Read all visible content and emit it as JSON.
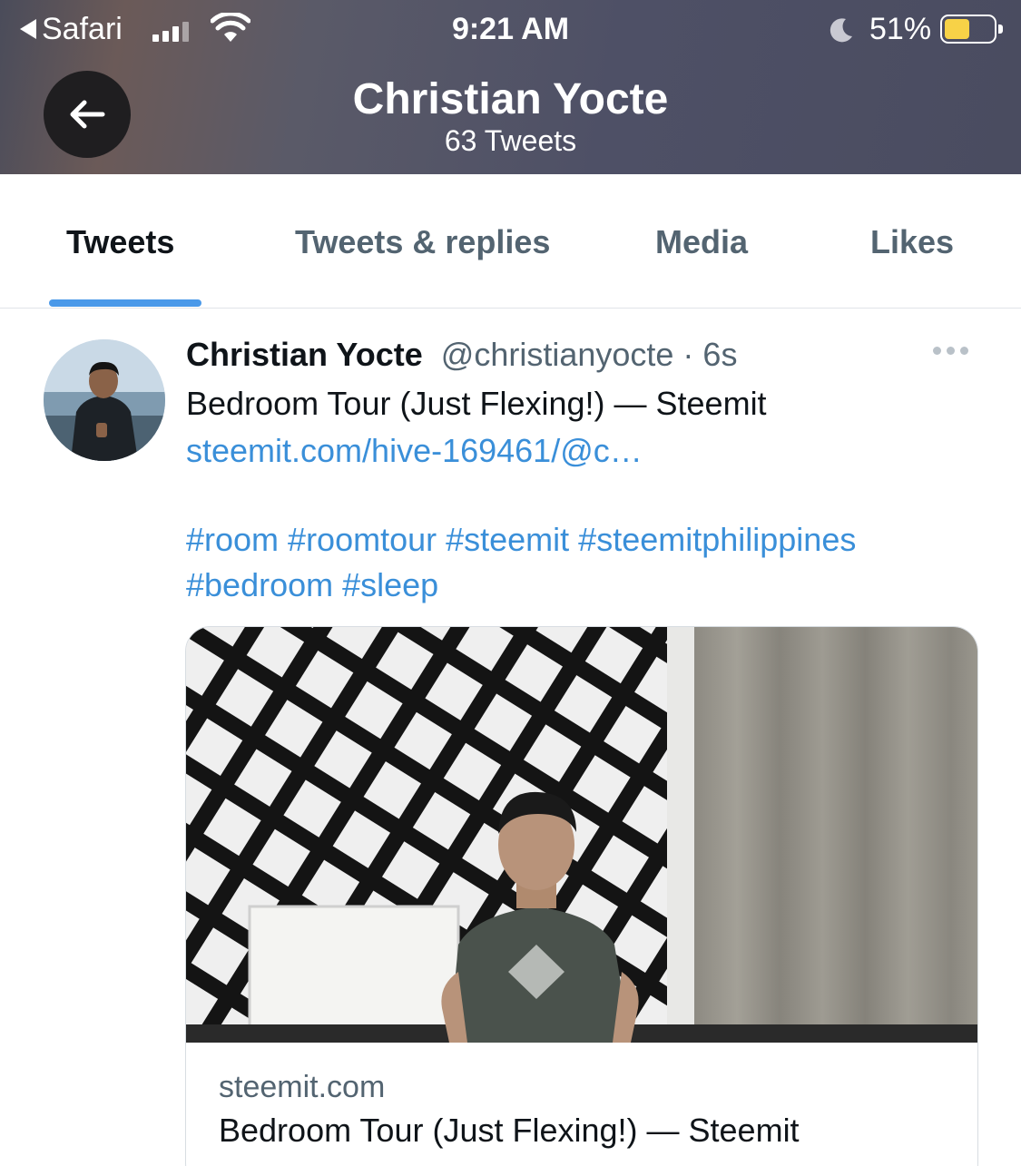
{
  "status_bar": {
    "back_app": "Safari",
    "time": "9:21 AM",
    "battery_percent": "51%",
    "battery_level": 0.51,
    "icons": [
      "signal-icon",
      "wifi-icon",
      "moon-icon",
      "battery-icon"
    ]
  },
  "header": {
    "profile_name": "Christian Yocte",
    "tweet_count": "63 Tweets",
    "back_icon": "arrow-left-icon"
  },
  "tabs": [
    {
      "label": "Tweets",
      "active": true
    },
    {
      "label": "Tweets & replies",
      "active": false
    },
    {
      "label": "Media",
      "active": false
    },
    {
      "label": "Likes",
      "active": false
    }
  ],
  "tweet": {
    "author_name": "Christian Yocte",
    "author_handle": "@christianyocte",
    "separator": " · ",
    "time": "6s",
    "text": "Bedroom Tour (Just Flexing!) — Steemit",
    "link": "steemit.com/hive-169461/@c…",
    "hashtags_line1": "#room #roomtour #steemit #steemitphilippines",
    "hashtags_line2": "#bedroom #sleep",
    "more_icon": "more-dots-icon",
    "card": {
      "domain": "steemit.com",
      "title": "Bedroom Tour (Just Flexing!) — Steemit"
    }
  },
  "colors": {
    "accent": "#4a99e9",
    "link": "#3a8fd9",
    "secondary_text": "#536471",
    "header_bg": "#4e5066"
  }
}
